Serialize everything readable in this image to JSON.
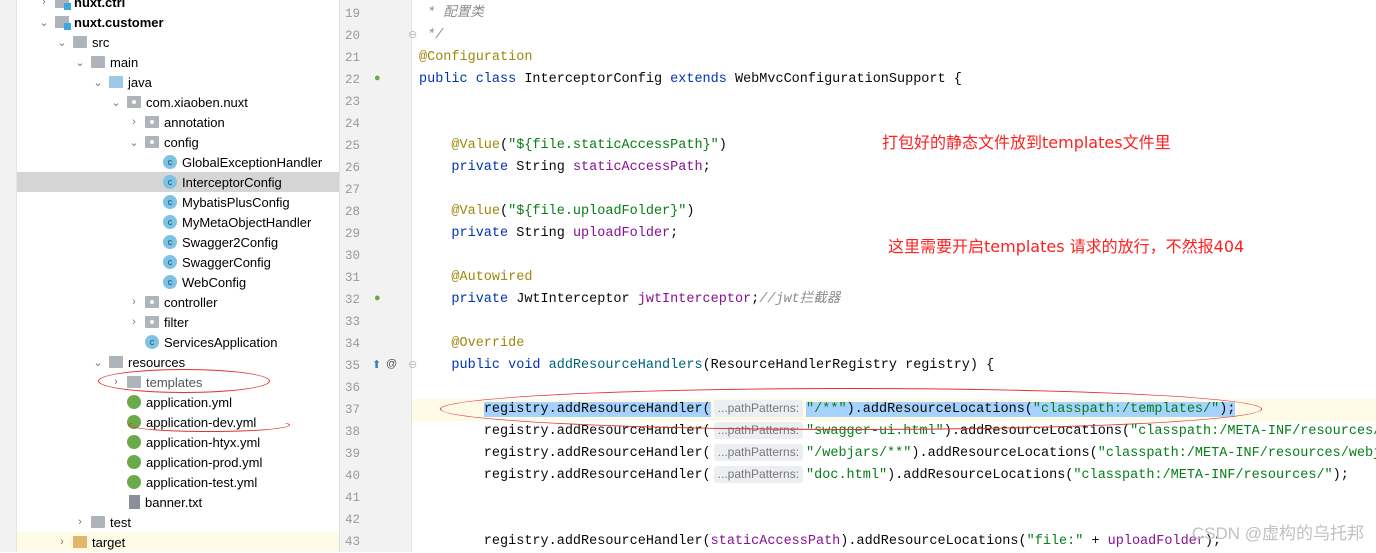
{
  "tree": [
    {
      "label": "nuxt.ctrl",
      "depth": 1,
      "chev": "right",
      "icon": "mod",
      "bold": true
    },
    {
      "label": "nuxt.customer",
      "depth": 1,
      "chev": "down",
      "icon": "mod",
      "bold": true
    },
    {
      "label": "src",
      "depth": 2,
      "chev": "down",
      "icon": "folder"
    },
    {
      "label": "main",
      "depth": 3,
      "chev": "down",
      "icon": "folder"
    },
    {
      "label": "java",
      "depth": 4,
      "chev": "down",
      "icon": "src"
    },
    {
      "label": "com.xiaoben.nuxt",
      "depth": 5,
      "chev": "down",
      "icon": "pkg"
    },
    {
      "label": "annotation",
      "depth": 6,
      "chev": "right",
      "icon": "pkg"
    },
    {
      "label": "config",
      "depth": 6,
      "chev": "down",
      "icon": "pkg"
    },
    {
      "label": "GlobalExceptionHandler",
      "depth": 7,
      "icon": "cls"
    },
    {
      "label": "InterceptorConfig",
      "depth": 7,
      "icon": "cls",
      "selected": true
    },
    {
      "label": "MybatisPlusConfig",
      "depth": 7,
      "icon": "cls"
    },
    {
      "label": "MyMetaObjectHandler",
      "depth": 7,
      "icon": "cls"
    },
    {
      "label": "Swagger2Config",
      "depth": 7,
      "icon": "cls"
    },
    {
      "label": "SwaggerConfig",
      "depth": 7,
      "icon": "cls"
    },
    {
      "label": "WebConfig",
      "depth": 7,
      "icon": "cls"
    },
    {
      "label": "controller",
      "depth": 6,
      "chev": "right",
      "icon": "pkg"
    },
    {
      "label": "filter",
      "depth": 6,
      "chev": "right",
      "icon": "pkg"
    },
    {
      "label": "ServicesApplication",
      "depth": 6,
      "icon": "cls"
    },
    {
      "label": "resources",
      "depth": 4,
      "chev": "down",
      "icon": "res"
    },
    {
      "label": "templates",
      "depth": 5,
      "chev": "right",
      "icon": "folder",
      "grey": true
    },
    {
      "label": "application.yml",
      "depth": 5,
      "icon": "yml"
    },
    {
      "label": "application-dev.yml",
      "depth": 5,
      "icon": "yml"
    },
    {
      "label": "application-htyx.yml",
      "depth": 5,
      "icon": "yml"
    },
    {
      "label": "application-prod.yml",
      "depth": 5,
      "icon": "yml"
    },
    {
      "label": "application-test.yml",
      "depth": 5,
      "icon": "yml"
    },
    {
      "label": "banner.txt",
      "depth": 5,
      "icon": "txt"
    },
    {
      "label": "test",
      "depth": 3,
      "chev": "right",
      "icon": "folder"
    },
    {
      "label": "target",
      "depth": 2,
      "chev": "right",
      "icon": "target",
      "highlight": true
    }
  ],
  "code": [
    {
      "n": "19",
      "t": [
        [
          " * 配置类",
          "cm"
        ]
      ]
    },
    {
      "n": "20",
      "t": [
        [
          " */",
          "cm"
        ]
      ]
    },
    {
      "n": "21",
      "t": [
        [
          "@Configuration",
          "an"
        ]
      ]
    },
    {
      "n": "22",
      "t": [
        [
          "public class ",
          "kw"
        ],
        [
          "InterceptorConfig ",
          ""
        ],
        [
          "extends ",
          "kw"
        ],
        [
          "WebMvcConfigurationSupport {",
          ""
        ]
      ]
    },
    {
      "n": "23",
      "t": []
    },
    {
      "n": "24",
      "t": []
    },
    {
      "n": "25",
      "t": [
        [
          "    @Value",
          "an"
        ],
        [
          "(",
          ""
        ],
        [
          "\"${file.staticAccessPath}\"",
          "st"
        ],
        [
          ")",
          ""
        ]
      ]
    },
    {
      "n": "26",
      "t": [
        [
          "    private ",
          "kw"
        ],
        [
          "String ",
          ""
        ],
        [
          "staticAccessPath",
          "fd"
        ],
        [
          ";",
          ""
        ]
      ]
    },
    {
      "n": "27",
      "t": []
    },
    {
      "n": "28",
      "t": [
        [
          "    @Value",
          "an"
        ],
        [
          "(",
          ""
        ],
        [
          "\"${file.uploadFolder}\"",
          "st"
        ],
        [
          ")",
          ""
        ]
      ]
    },
    {
      "n": "29",
      "t": [
        [
          "    private ",
          "kw"
        ],
        [
          "String ",
          ""
        ],
        [
          "uploadFolder",
          "fd"
        ],
        [
          ";",
          ""
        ]
      ]
    },
    {
      "n": "30",
      "t": []
    },
    {
      "n": "31",
      "t": [
        [
          "    @Autowired",
          "an"
        ]
      ]
    },
    {
      "n": "32",
      "t": [
        [
          "    private ",
          "kw"
        ],
        [
          "JwtInterceptor ",
          ""
        ],
        [
          "jwtInterceptor",
          "fd"
        ],
        [
          ";",
          ""
        ],
        [
          "//jwt拦截器",
          "cm"
        ]
      ]
    },
    {
      "n": "33",
      "t": []
    },
    {
      "n": "34",
      "t": [
        [
          "    @Override",
          "an"
        ]
      ]
    },
    {
      "n": "35",
      "t": [
        [
          "    public void ",
          "kw"
        ],
        [
          "addResourceHandlers",
          "mt"
        ],
        [
          "(ResourceHandlerRegistry registry) {",
          ""
        ]
      ]
    },
    {
      "n": "36",
      "t": []
    },
    {
      "n": "37",
      "cur": true,
      "t": [
        [
          "        ",
          ""
        ],
        [
          "registry.addResourceHandler(",
          "sel"
        ],
        [
          "...pathPatterns:",
          "hint"
        ],
        [
          "\"/**\"",
          "st sel"
        ],
        [
          ").addResourceLocations(",
          "sel"
        ],
        [
          "\"classpath:/templates/\"",
          "st sel"
        ],
        [
          ");",
          "sel"
        ]
      ]
    },
    {
      "n": "38",
      "t": [
        [
          "        registry.addResourceHandler(",
          ""
        ],
        [
          "...pathPatterns:",
          "hint"
        ],
        [
          "\"swagger-ui.html\"",
          "st"
        ],
        [
          ").addResourceLocations(",
          ""
        ],
        [
          "\"classpath:/META-INF/resources/\"",
          "st"
        ],
        [
          ");",
          ""
        ]
      ]
    },
    {
      "n": "39",
      "t": [
        [
          "        registry.addResourceHandler(",
          ""
        ],
        [
          "...pathPatterns:",
          "hint"
        ],
        [
          "\"/webjars/**\"",
          "st"
        ],
        [
          ").addResourceLocations(",
          ""
        ],
        [
          "\"classpath:/META-INF/resources/webjars/\"",
          "st"
        ],
        [
          ");",
          ""
        ]
      ]
    },
    {
      "n": "40",
      "t": [
        [
          "        registry.addResourceHandler(",
          ""
        ],
        [
          "...pathPatterns:",
          "hint"
        ],
        [
          "\"doc.html\"",
          "st"
        ],
        [
          ").addResourceLocations(",
          ""
        ],
        [
          "\"classpath:/META-INF/resources/\"",
          "st"
        ],
        [
          ");",
          ""
        ]
      ]
    },
    {
      "n": "41",
      "t": []
    },
    {
      "n": "42",
      "t": []
    },
    {
      "n": "43",
      "t": [
        [
          "        registry.addResourceHandler(",
          ""
        ],
        [
          "staticAccessPath",
          "fd"
        ],
        [
          ").addResourceLocations(",
          ""
        ],
        [
          "\"file:\"",
          "st"
        ],
        [
          " + ",
          ""
        ],
        [
          "uploadFolder",
          "fd"
        ],
        [
          ");",
          ""
        ]
      ]
    }
  ],
  "annotations": {
    "note1": "打包好的静态文件放到templates文件里",
    "note2": "这里需要开启templates 请求的放行，不然报404",
    "color": "#ff2020"
  },
  "watermark": "CSDN @虚构的乌托邦"
}
